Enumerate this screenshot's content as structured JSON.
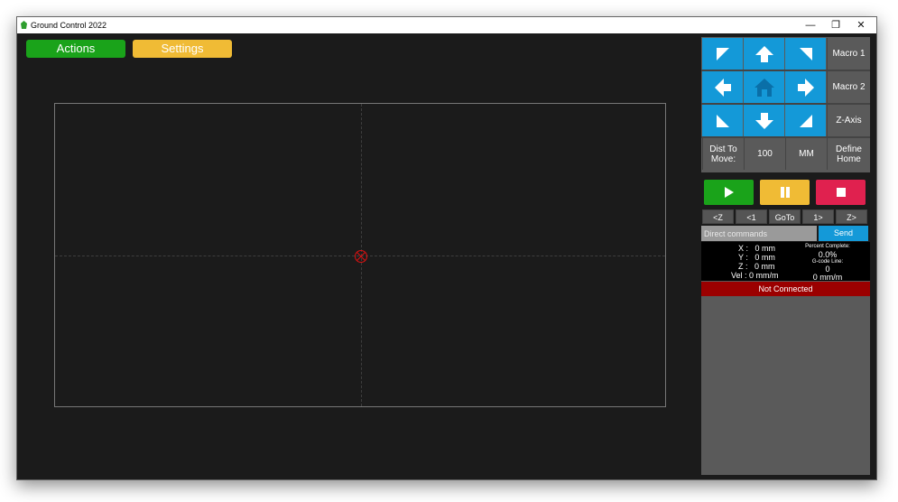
{
  "window": {
    "title": "Ground Control 2022",
    "minimize": "—",
    "restore": "❐",
    "close": "✕"
  },
  "toolbar": {
    "actions_label": "Actions",
    "settings_label": "Settings",
    "actions_color": "#1aa31a",
    "settings_color": "#f0bb35"
  },
  "jog": {
    "up_left_icon": "arrow-up-left-icon",
    "up_icon": "arrow-up-icon",
    "up_right_icon": "arrow-up-right-icon",
    "left_icon": "arrow-left-icon",
    "home_icon": "home-icon",
    "right_icon": "arrow-right-icon",
    "down_left_icon": "arrow-down-left-icon",
    "down_icon": "arrow-down-icon",
    "down_right_icon": "arrow-down-right-icon",
    "color": "#1499d8"
  },
  "side_buttons": {
    "macro1": "Macro 1",
    "macro2": "Macro 2",
    "zaxis": "Z-Axis",
    "define_home_1": "Define",
    "define_home_2": "Home"
  },
  "distance": {
    "label_1": "Dist To",
    "label_2": "Move:",
    "value": "100",
    "units": "MM"
  },
  "run_controls": {
    "play_color": "#1aa31a",
    "pause_color": "#f0bb35",
    "stop_color": "#e0214f"
  },
  "navigation": {
    "z_back": "<Z",
    "back_1": "<1",
    "goto": "GoTo",
    "forward_1": "1>",
    "z_forward": "Z>"
  },
  "command": {
    "placeholder": "Direct commands",
    "send_label": "Send"
  },
  "readout": {
    "x": "X :   0 mm",
    "y": "Y :   0 mm",
    "z": "Z :   0 mm",
    "vel": "Vel : 0 mm/m",
    "percent_label": "Percent Complete:",
    "percent_value": "0.0%",
    "gcode_label": "G-code Line:",
    "gcode_value": "0",
    "feed_value": "0 mm/m"
  },
  "status": {
    "text": "Not Connected",
    "color": "#9b0000"
  }
}
